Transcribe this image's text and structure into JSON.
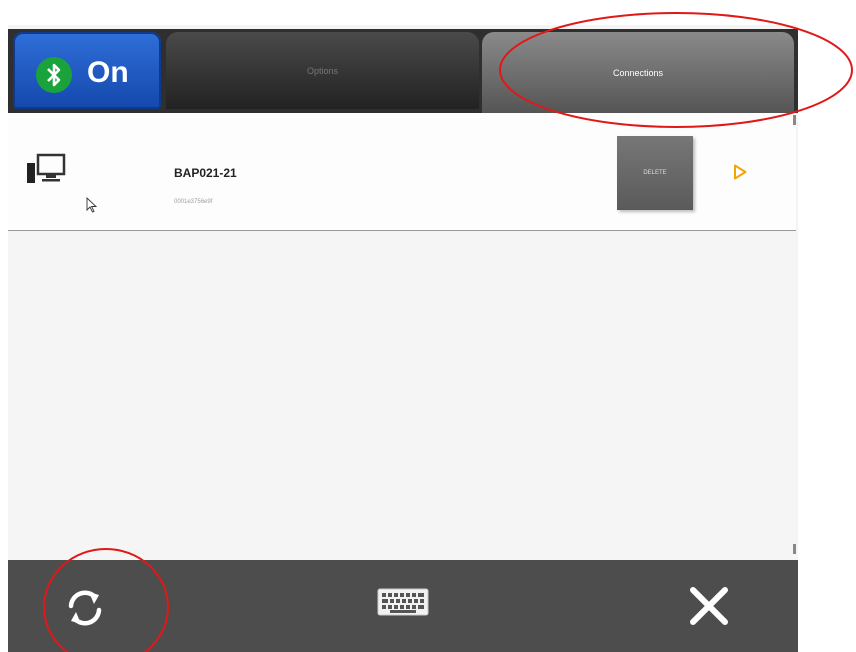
{
  "header": {
    "bluetooth_state": "On",
    "tabs": [
      {
        "label": "Options"
      },
      {
        "label": "Connections"
      }
    ]
  },
  "devices": [
    {
      "name": "BAP021-21",
      "address": "0001e3756e9f",
      "delete_label": "DELETE"
    }
  ],
  "colors": {
    "bluetooth_blue": "#1f5cc7",
    "bluetooth_green": "#1aa33a",
    "chevron": "#f0a500",
    "annotation": "#e01818"
  }
}
